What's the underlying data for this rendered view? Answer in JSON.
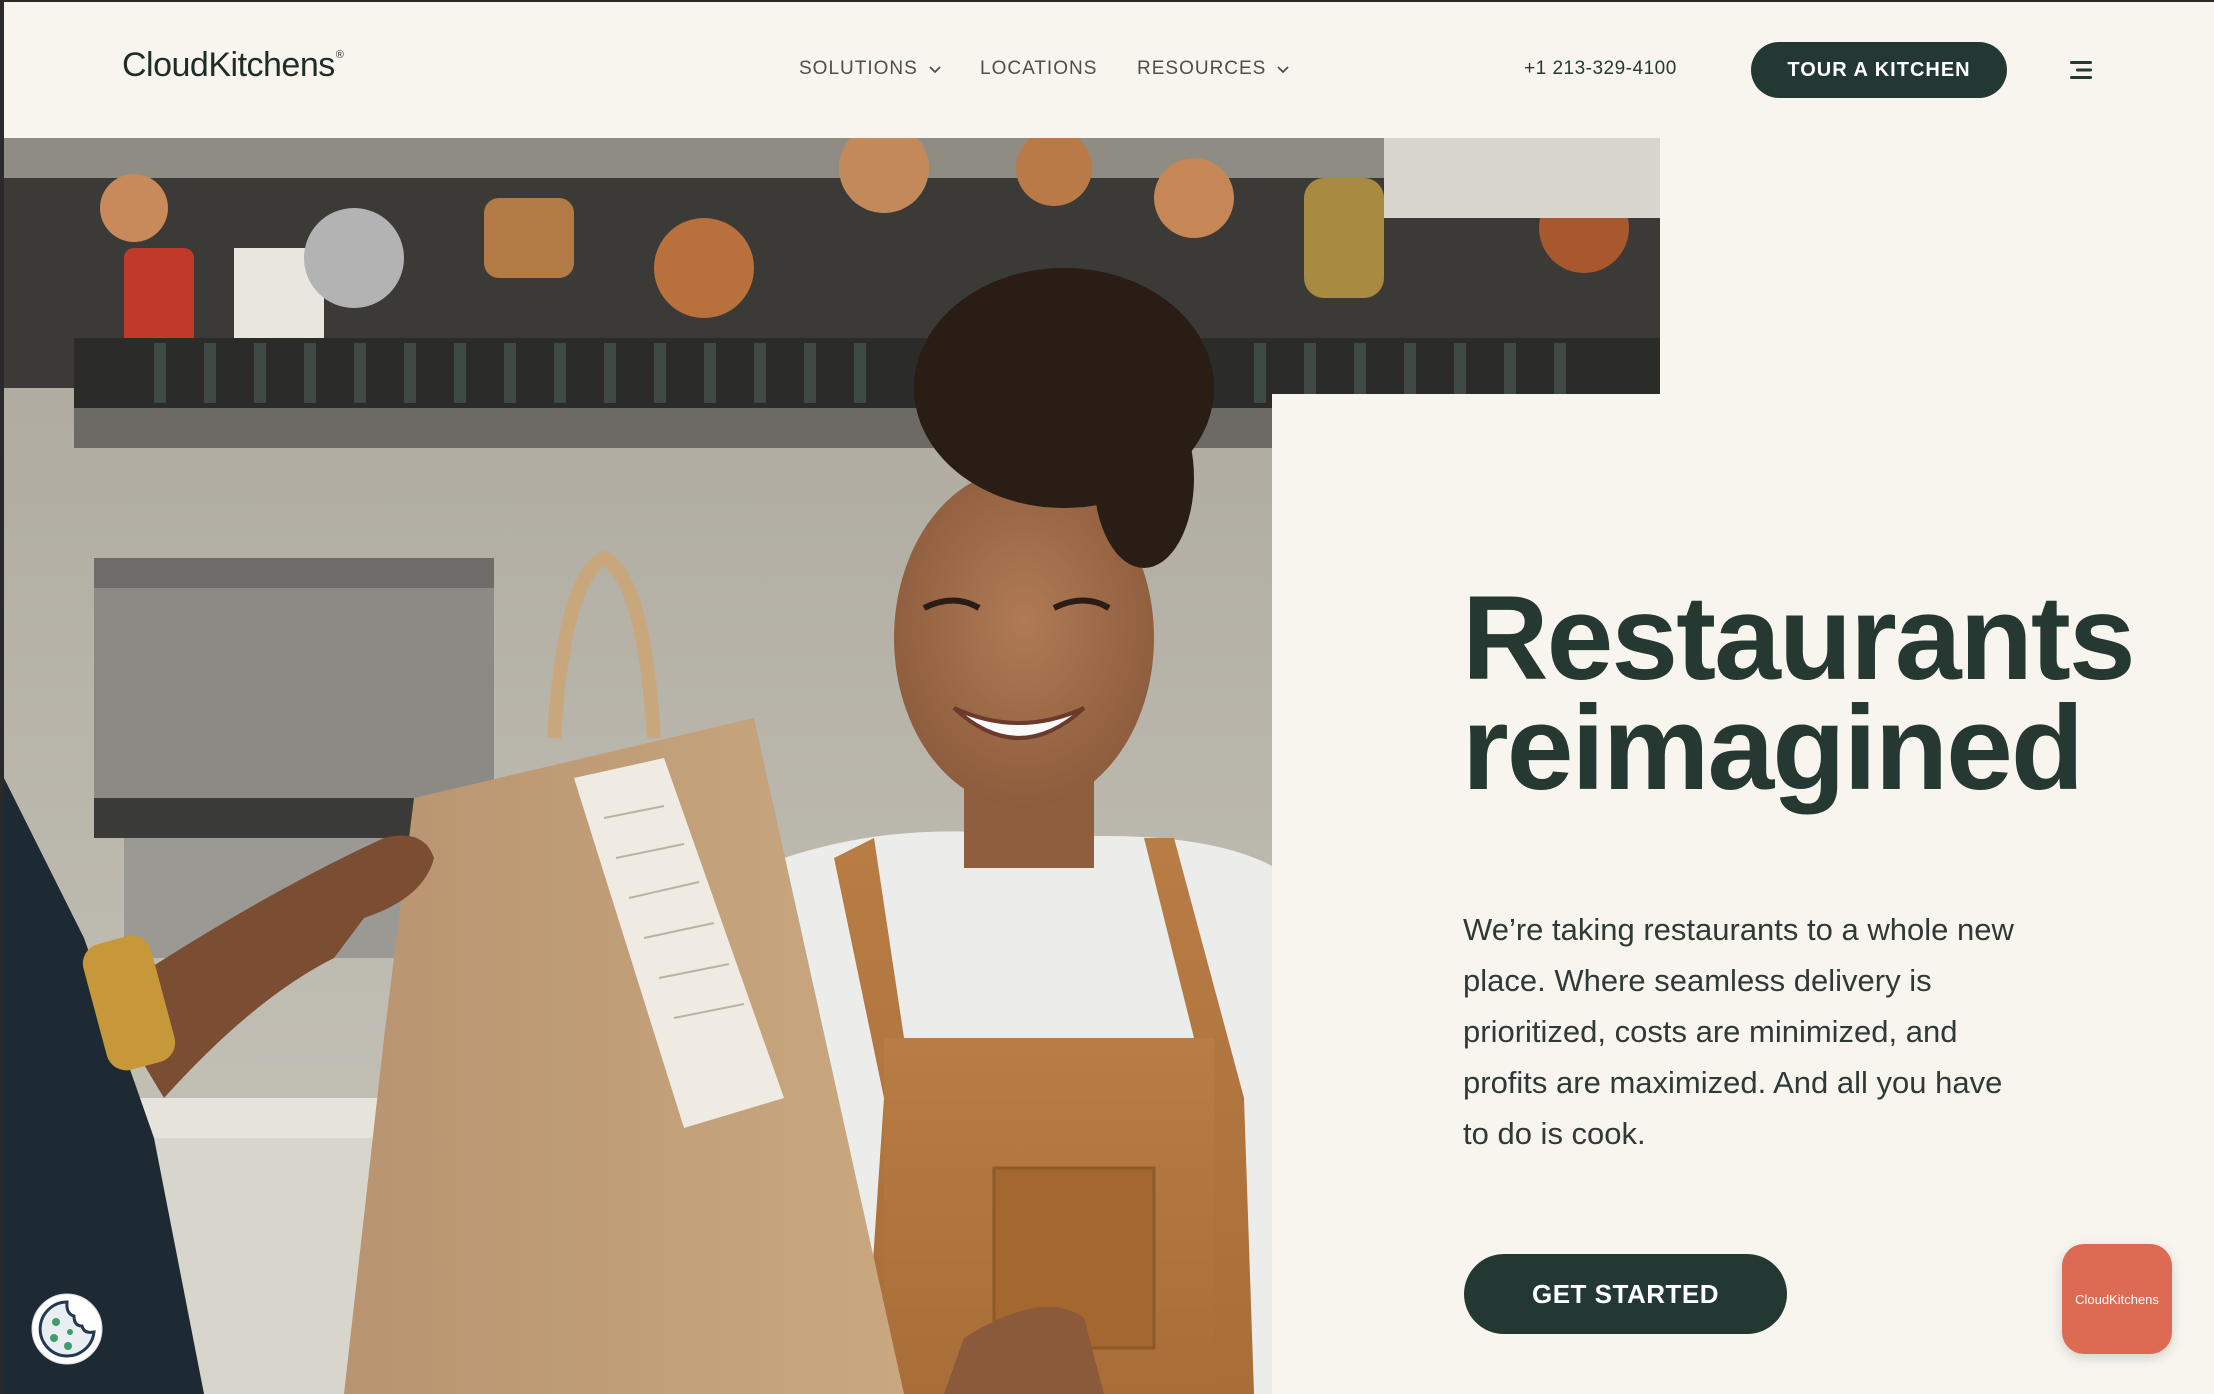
{
  "header": {
    "logo": "CloudKitchens",
    "logo_mark": "®",
    "nav": [
      {
        "label": "SOLUTIONS",
        "has_dropdown": true
      },
      {
        "label": "LOCATIONS",
        "has_dropdown": false
      },
      {
        "label": "RESOURCES",
        "has_dropdown": true
      }
    ],
    "phone": "+1 213-329-4100",
    "tour_button": "TOUR A KITCHEN",
    "menu_icon": "hamburger-menu-icon"
  },
  "hero": {
    "title_line1": "Restaurants",
    "title_line2": "reimagined",
    "body": "We’re taking restaurants to a whole new place. Where seamless delivery is prioritized, costs are minimized, and profits are maximized. And all you have to do is cook.",
    "cta": "GET STARTED",
    "image_icon": "kitchen-photo"
  },
  "widgets": {
    "chat_label": "CloudKitchens",
    "cookie_icon": "cookie-icon"
  },
  "colors": {
    "background": "#f7f5ee",
    "primary_dark": "#243833",
    "accent": "#dd6a52"
  }
}
